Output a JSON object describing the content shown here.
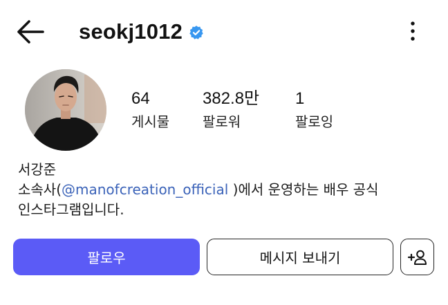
{
  "header": {
    "username": "seokj1012",
    "verified": true,
    "back_icon": "arrow-left-icon",
    "menu_icon": "more-vertical-icon"
  },
  "profile": {
    "avatar_icon": "profile-photo",
    "stats": {
      "posts": {
        "value": "64",
        "label": "게시물"
      },
      "followers": {
        "value": "382.8만",
        "label": "팔로워"
      },
      "following": {
        "value": "1",
        "label": "팔로잉"
      }
    },
    "bio": {
      "name": "서강준",
      "line1_prefix": "소속사(",
      "mention": "@manofcreation_official",
      "line1_suffix": " )에서 운영하는 배우 공식",
      "line2": "인스타그램입니다."
    }
  },
  "actions": {
    "follow_label": "팔로우",
    "message_label": "메시지 보내기",
    "add_user_icon": "add-user-icon"
  },
  "colors": {
    "accent": "#5b5bf6",
    "verified_badge": "#3897f0",
    "mention": "#3a62b8"
  }
}
